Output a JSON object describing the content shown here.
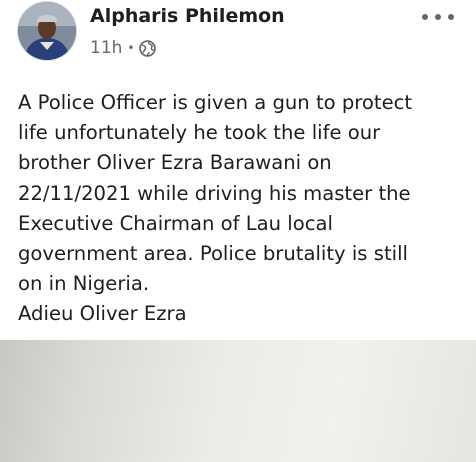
{
  "post": {
    "author": "Alpharis Philemon",
    "time": "11h",
    "separator": "•",
    "audience_icon": "globe-icon",
    "more_icon": "more-options-icon",
    "text_lines": [
      "A Police Officer is given a gun to protect",
      "life unfortunately he took the life our",
      "brother Oliver Ezra Barawani on",
      "22/11/2021 while driving his master the",
      "Executive Chairman of Lau local",
      "government area. Police brutality is still",
      "on in Nigeria.",
      "Adieu Oliver Ezra"
    ]
  },
  "colors": {
    "text": "#1c1e21",
    "secondary_text": "#65676b",
    "icon": "#606770"
  }
}
